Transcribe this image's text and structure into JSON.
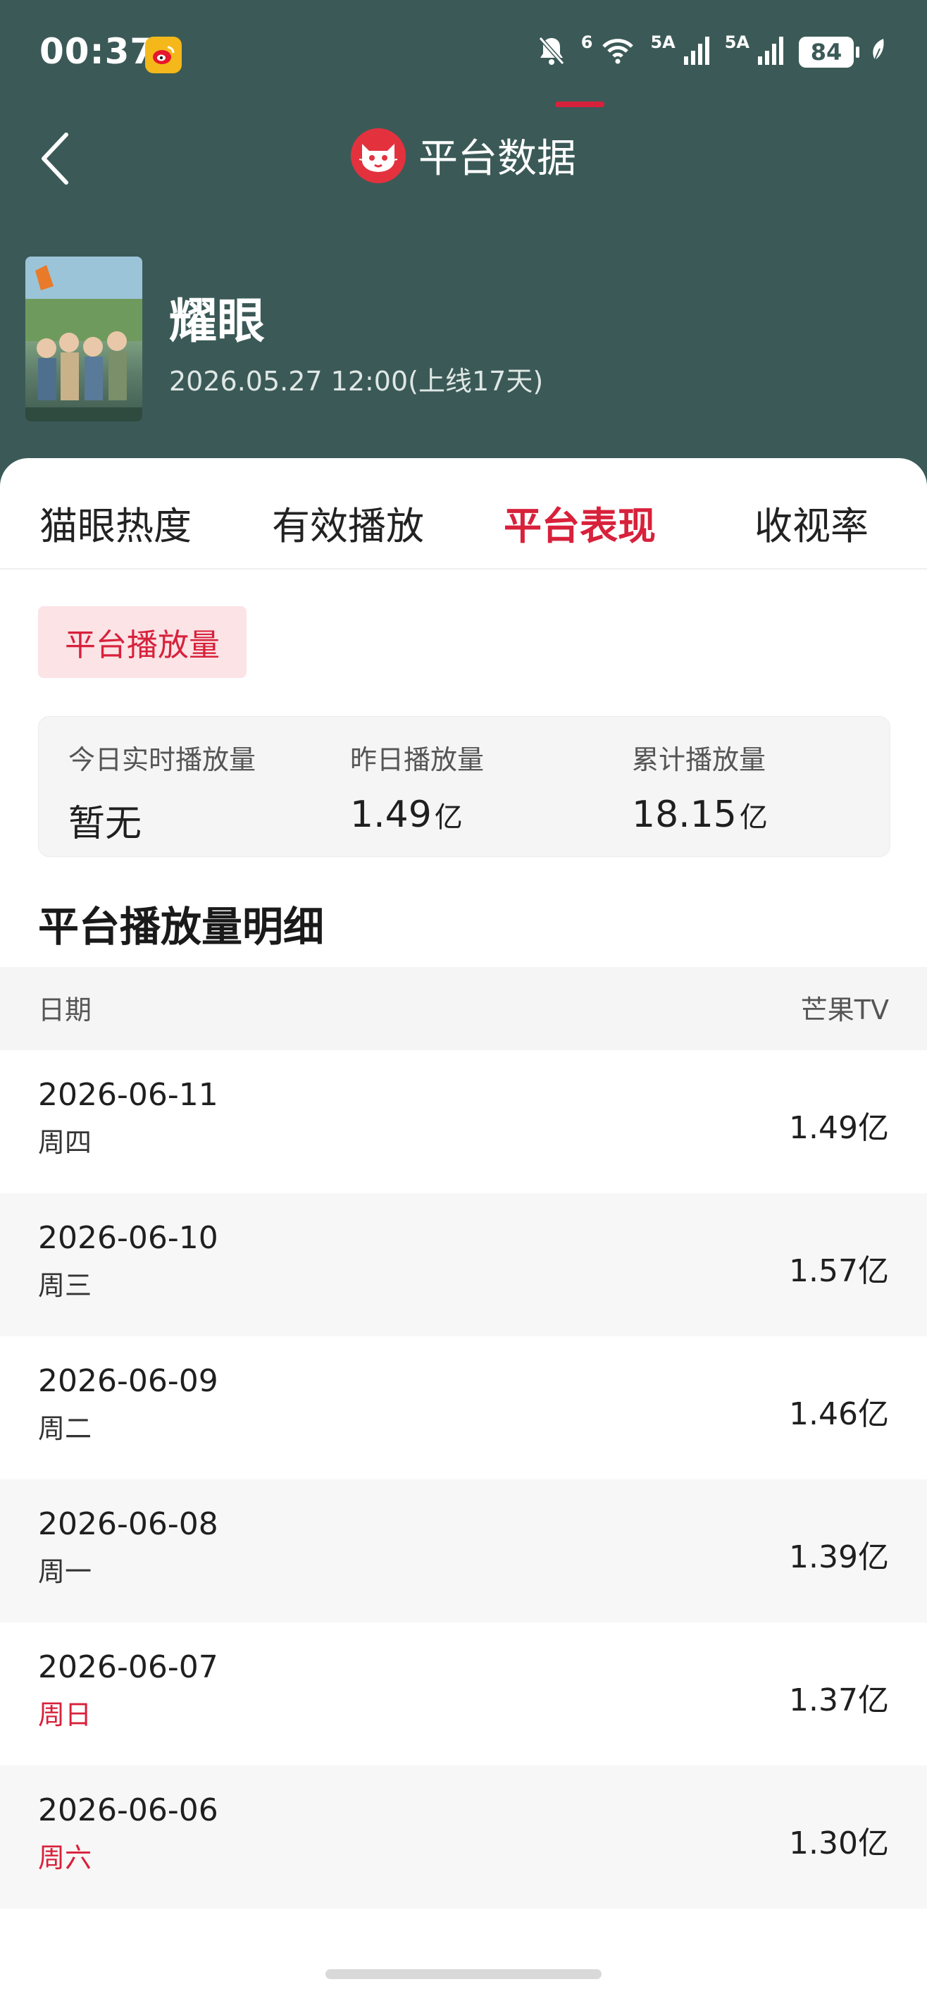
{
  "status_bar": {
    "time": "00:37",
    "network_labels": [
      "6",
      "5A",
      "5A"
    ],
    "battery": "84",
    "icons": [
      "weibo-icon",
      "bell-off-icon",
      "wifi-icon",
      "signal-icon",
      "signal-icon",
      "battery-icon",
      "leaf-icon"
    ]
  },
  "header": {
    "back_icon": "back-chevron-icon",
    "logo": "maoyan-cat-icon",
    "title": "平台数据"
  },
  "movie": {
    "name": "耀眼",
    "release": "2026.05.27 12:00(上线17天)"
  },
  "tabs": [
    {
      "label": "猫眼热度",
      "active": false
    },
    {
      "label": "有效播放",
      "active": false
    },
    {
      "label": "平台表现",
      "active": true
    },
    {
      "label": "收视率",
      "active": false
    }
  ],
  "chip": {
    "label": "平台播放量"
  },
  "summary": [
    {
      "label": "今日实时播放量",
      "value": "暂无",
      "unit": ""
    },
    {
      "label": "昨日播放量",
      "value": "1.49",
      "unit": "亿"
    },
    {
      "label": "累计播放量",
      "value": "18.15",
      "unit": "亿"
    }
  ],
  "detail": {
    "title": "平台播放量明细",
    "columns": {
      "date": "日期",
      "platform": "芒果TV"
    },
    "rows": [
      {
        "date": "2026-06-11",
        "weekday": "周四",
        "weekend": false,
        "value": "1.49亿"
      },
      {
        "date": "2026-06-10",
        "weekday": "周三",
        "weekend": false,
        "value": "1.57亿"
      },
      {
        "date": "2026-06-09",
        "weekday": "周二",
        "weekend": false,
        "value": "1.46亿"
      },
      {
        "date": "2026-06-08",
        "weekday": "周一",
        "weekend": false,
        "value": "1.39亿"
      },
      {
        "date": "2026-06-07",
        "weekday": "周日",
        "weekend": true,
        "value": "1.37亿"
      },
      {
        "date": "2026-06-06",
        "weekday": "周六",
        "weekend": true,
        "value": "1.30亿"
      }
    ]
  },
  "colors": {
    "header_bg": "#3b5a57",
    "accent": "#d8213b",
    "chip_bg": "#fbe3e6"
  }
}
